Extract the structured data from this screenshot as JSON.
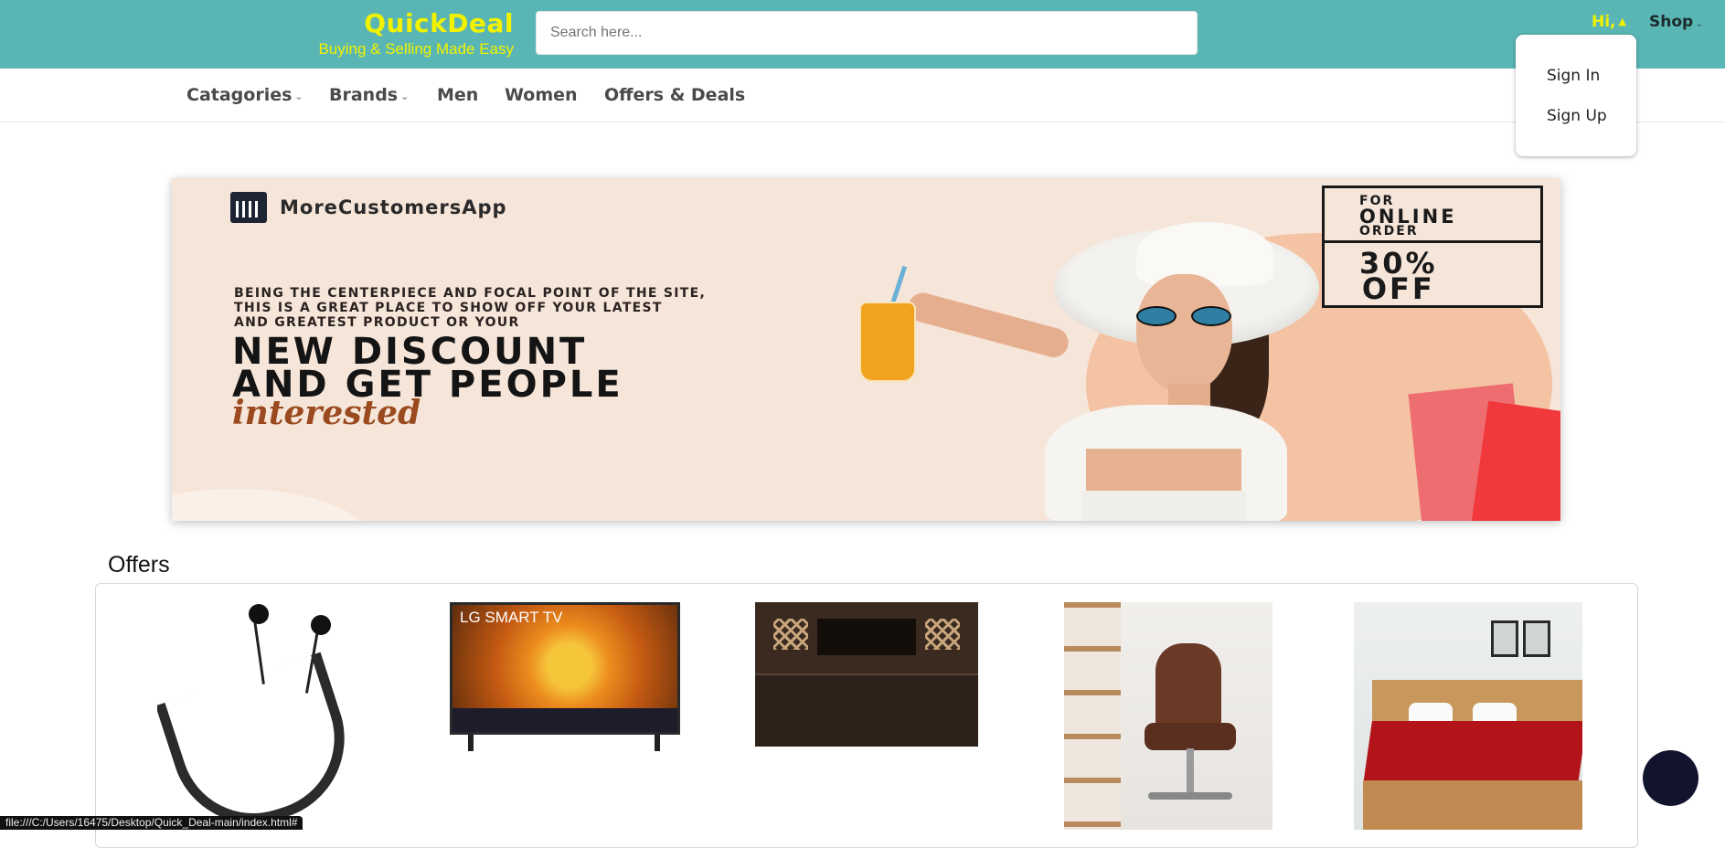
{
  "header": {
    "logo_title": "QuickDeal",
    "logo_tagline": "Buying & Selling Made Easy",
    "search_placeholder": "Search here...",
    "greeting": "Hi,",
    "shop_label": "Shop",
    "bg_color": "#59b6b4",
    "accent_color": "#f2f200"
  },
  "nav": {
    "items": [
      {
        "label": "Catagories",
        "has_dropdown": true
      },
      {
        "label": "Brands",
        "has_dropdown": true
      },
      {
        "label": "Men",
        "has_dropdown": false
      },
      {
        "label": "Women",
        "has_dropdown": false
      },
      {
        "label": "Offers & Deals",
        "has_dropdown": false
      }
    ]
  },
  "account_dropdown": {
    "items": [
      "Sign In",
      "Sign Up"
    ]
  },
  "banner": {
    "brand": "MoreCustomersApp",
    "intro_lines": [
      "BEING THE CENTERPIECE AND FOCAL POINT OF THE SITE,",
      "THIS IS A GREAT PLACE TO SHOW OFF YOUR LATEST",
      "AND GREATEST PRODUCT OR YOUR"
    ],
    "headline_lines": [
      "NEW DISCOUNT",
      "AND GET PEOPLE"
    ],
    "script_text": "interested",
    "promo_for": "FOR",
    "promo_online": "ONLINE",
    "promo_order": "ORDER",
    "promo_percent": "30%",
    "promo_off": "OFF"
  },
  "offers": {
    "title": "Offers",
    "products": [
      {
        "name": "neckband-earphones"
      },
      {
        "name": "lg-smart-tv",
        "screen_text": "LG SMART TV"
      },
      {
        "name": "wooden-bed"
      },
      {
        "name": "office-chair"
      },
      {
        "name": "red-mattress"
      }
    ]
  },
  "status_bar": {
    "url": "file:///C:/Users/16475/Desktop/Quick_Deal-main/index.html#"
  }
}
